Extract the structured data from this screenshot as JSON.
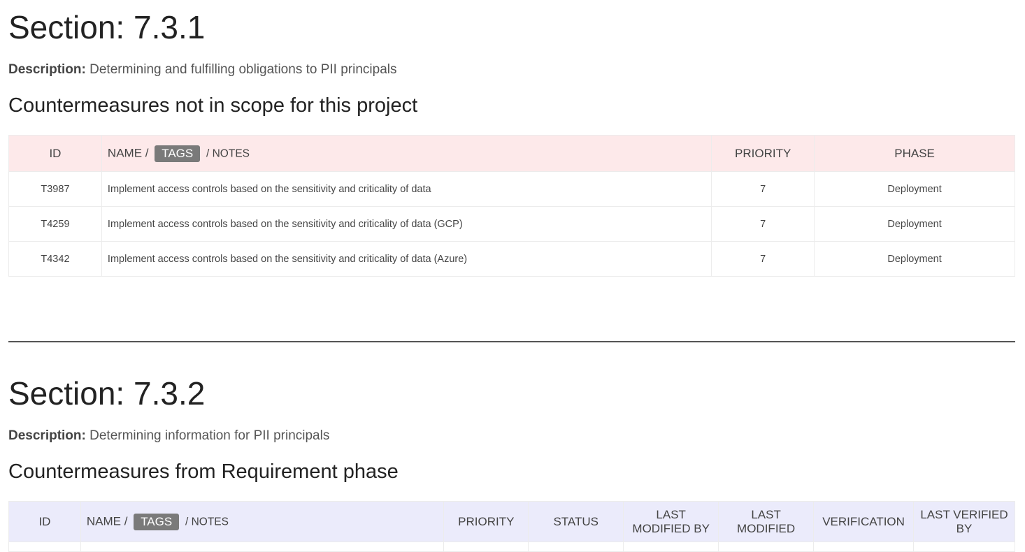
{
  "sections": [
    {
      "title": "Section: 7.3.1",
      "description_label": "Description:",
      "description": "Determining and fulfilling obligations to PII principals",
      "subheading": "Countermeasures not in scope for this project",
      "table": {
        "headers": {
          "id": "ID",
          "name": "NAME /",
          "tags": "TAGS",
          "notes": "/ NOTES",
          "priority": "PRIORITY",
          "phase": "PHASE"
        },
        "rows": [
          {
            "id": "T3987",
            "name": "Implement access controls based on the sensitivity and criticality of data",
            "priority": "7",
            "phase": "Deployment"
          },
          {
            "id": "T4259",
            "name": "Implement access controls based on the sensitivity and criticality of data (GCP)",
            "priority": "7",
            "phase": "Deployment"
          },
          {
            "id": "T4342",
            "name": "Implement access controls based on the sensitivity and criticality of data (Azure)",
            "priority": "7",
            "phase": "Deployment"
          }
        ]
      }
    },
    {
      "title": "Section: 7.3.2",
      "description_label": "Description:",
      "description": "Determining information for PII principals",
      "subheading": "Countermeasures from Requirement phase",
      "table": {
        "headers": {
          "id": "ID",
          "name": "NAME /",
          "tags": "TAGS",
          "notes": "/ NOTES",
          "priority": "PRIORITY",
          "status": "STATUS",
          "last_modified_by_1": "LAST",
          "last_modified_by_2": "MODIFIED BY",
          "last_modified_1": "LAST",
          "last_modified_2": "MODIFIED",
          "verification": "VERIFICATION",
          "last_verified_by_1": "LAST VERIFIED",
          "last_verified_by_2": "BY"
        }
      }
    }
  ],
  "colors": {
    "table1_header_bg": "#fde9ea",
    "table2_header_bg": "#ebebfb",
    "tag_badge_bg": "#7a7a7a"
  }
}
